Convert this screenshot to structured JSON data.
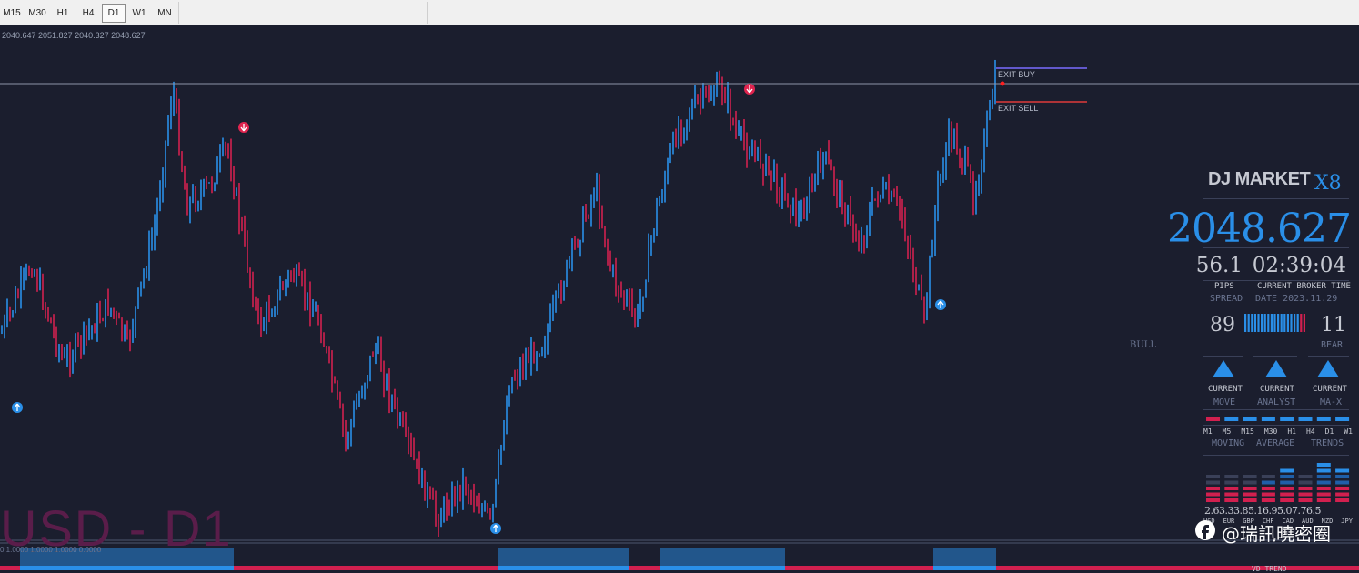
{
  "toolbar": {
    "timeframes": [
      "M15",
      "M30",
      "H1",
      "H4",
      "D1",
      "W1",
      "MN"
    ],
    "active": "D1"
  },
  "chart": {
    "ohlc_readout": "2040.647 2051.827 2040.327 2048.627",
    "watermark": "USD - D1",
    "exit_buy_label": "EXIT BUY",
    "exit_sell_label": "EXIT SELL",
    "bull_label": "BULL",
    "indicator_readout": "0 1.0000 1.0000 1.0000 0.0000"
  },
  "panel": {
    "logo": "DJ MARKET",
    "edition": "X8",
    "price": "2048.627",
    "pips": "56.1",
    "broker_time": "02:39:04",
    "pips_label": "PIPS",
    "spread_label": "SPREAD",
    "current_broker_time_label": "CURRENT BROKER TIME",
    "date_label": "DATE 2023.11.29",
    "bull_value": "89",
    "bear_value": "11",
    "bear_label": "BEAR",
    "signals": [
      {
        "current": "CURRENT",
        "name": "MOVE"
      },
      {
        "current": "CURRENT",
        "name": "ANALYST"
      },
      {
        "current": "CURRENT",
        "name": "MA-X"
      }
    ],
    "trend_timeframes": [
      "M1",
      "M5",
      "M15",
      "M30",
      "H1",
      "H4",
      "D1",
      "W1"
    ],
    "trend_words": [
      "MOVING",
      "AVERAGE",
      "TRENDS"
    ],
    "currency_values": "2.63.33.85.16.95.07.76.5",
    "currencies": [
      "USD",
      "EUR",
      "GBP",
      "CHF",
      "CAD",
      "AUD",
      "NZD",
      "JPY"
    ],
    "bottom_label": "VD TREND"
  },
  "site_watermark": "@瑞訊曉密圈",
  "colors": {
    "background": "#1b1e2e",
    "bull": "#2a8fe8",
    "bear": "#d2204f",
    "exit_buy_line": "#7b6cff",
    "exit_sell_line": "#e03a3a"
  }
}
